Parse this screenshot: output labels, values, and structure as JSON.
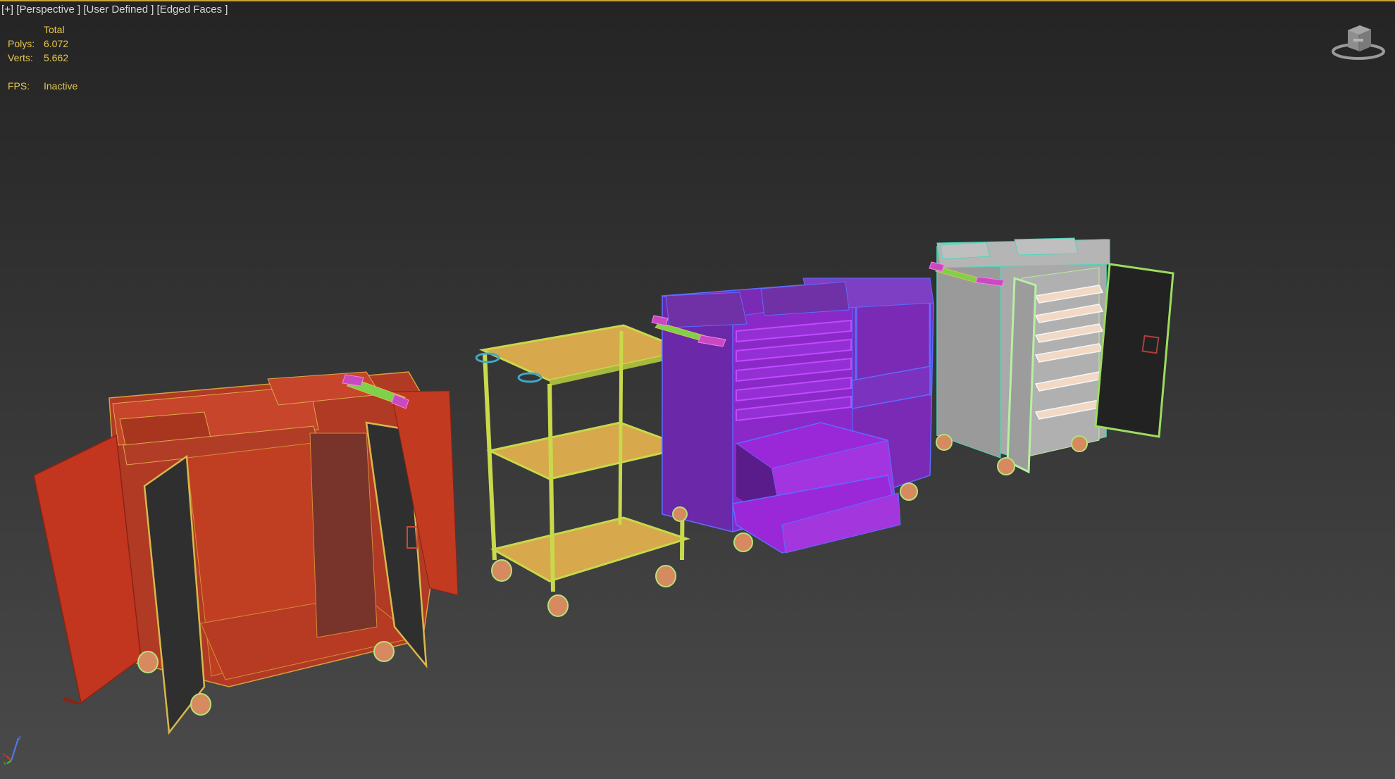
{
  "viewport": {
    "labels": {
      "menu": "[+]",
      "view": "[Perspective ]",
      "shading": "[User Defined ]",
      "mode": "[Edged Faces ]"
    },
    "stats": {
      "header": "Total",
      "polys_label": "Polys:",
      "polys_value": "6.072",
      "verts_label": "Verts:",
      "verts_value": "5.662",
      "fps_label": "FPS:",
      "fps_value": "Inactive"
    }
  },
  "scene": {
    "objects": [
      {
        "name": "red-cabinet-cart",
        "color": "#c23b22",
        "edge": "#d4a23a"
      },
      {
        "name": "yellow-shelf-cart",
        "color": "#d7a84c",
        "edge": "#b8d23f"
      },
      {
        "name": "purple-drawer-cart",
        "color": "#8a25c6",
        "edge": "#6a5cff"
      },
      {
        "name": "grey-housekeeping-cart",
        "color": "#a8a8a8",
        "edge": "#4fd6b8"
      }
    ]
  },
  "icons": {
    "viewcube": "viewcube-icon",
    "axis": "axis-tripod-icon"
  },
  "colors": {
    "stats_text": "#e6c84a",
    "label_text": "#d8d8d8",
    "active_border": "#c9a23a"
  }
}
